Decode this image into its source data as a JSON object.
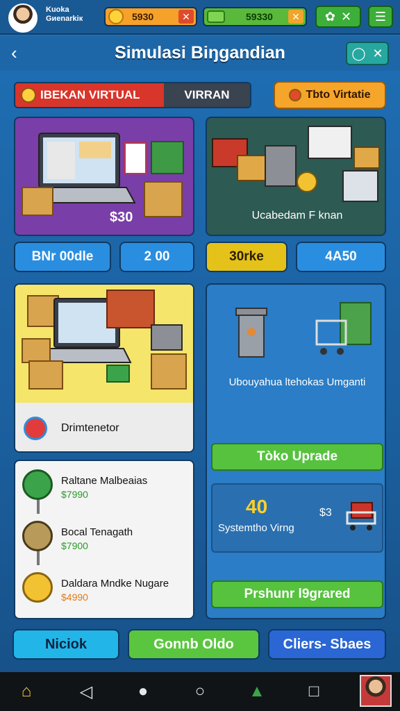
{
  "topbar": {
    "player_name_line1": "Kuoka",
    "player_name_line2": "Gиenarkiк",
    "coins": "5930",
    "cash": "59330",
    "coins_add": "✕",
    "cash_add": "✕"
  },
  "header": {
    "title": "Simulasi Biŋgandian",
    "back_glyph": "‹",
    "actions": [
      "◯",
      "✕"
    ]
  },
  "tabs": {
    "active": "IBEKAN VIRTUAL",
    "idle": "VIRRAN",
    "store_button": "Tbto Virtatie"
  },
  "cards": {
    "purple_price": "$30",
    "dark_label": "Ucabedam F knan"
  },
  "stat_buttons": [
    "BNr 00dle",
    "2 00",
    "30rke",
    "4A50"
  ],
  "feature_card": {
    "label": "Drimtenetor"
  },
  "right_panel": {
    "caption": "Ubouyahua ltehokas Umganti",
    "upgrade_button": "Tòko Uprade",
    "big_number": "40",
    "small_cost": "$3",
    "inner_caption": "Systemtho Virng",
    "premium_button": "Prshunr l9grared"
  },
  "list": [
    {
      "title": "Raltane Malbeaias",
      "price": "$7990",
      "icon": "clock-green-icon"
    },
    {
      "title": "Bocal Tenagath",
      "price": "$7900",
      "icon": "stopwatch-icon"
    },
    {
      "title": "Daldara Mndke Nugare",
      "price": "$4990",
      "icon": "gold-coin-icon"
    }
  ],
  "bottom_tabs": [
    "Niciok",
    "Gonnb Oldo",
    "Cliers- Sbaes"
  ],
  "colors": {
    "bg": "#1f6fb5",
    "accent_red": "#d8352b",
    "accent_orange": "#f5a52a",
    "accent_green": "#56c23e",
    "accent_yellow": "#e5c21a"
  }
}
